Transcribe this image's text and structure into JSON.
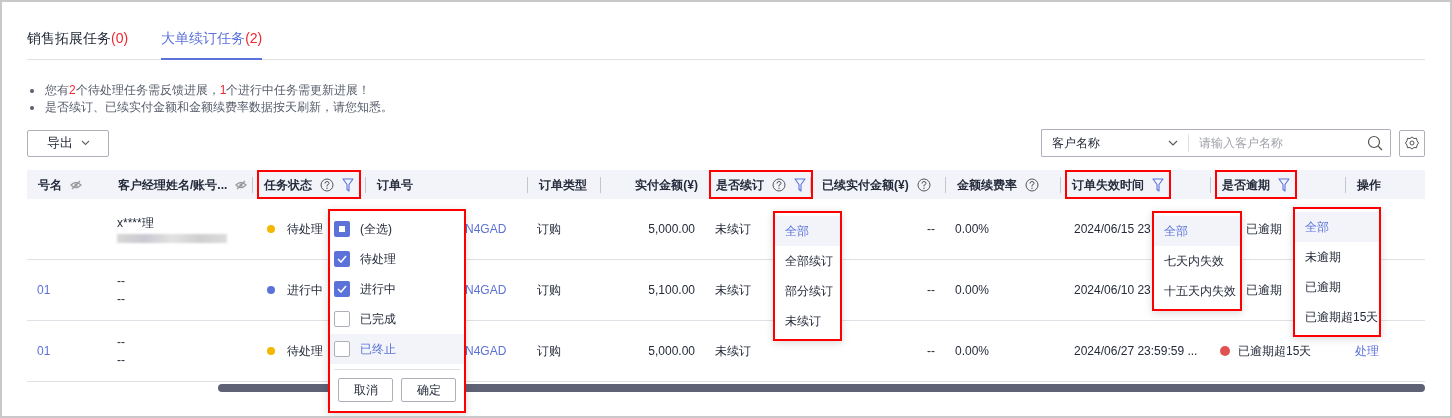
{
  "tabs": [
    {
      "label": "销售拓展任务",
      "count": "(0)",
      "selected": false
    },
    {
      "label": "大单续订任务",
      "count": "(2)",
      "selected": true
    }
  ],
  "notices": [
    [
      {
        "text": "您有",
        "highlight": false
      },
      {
        "text": "2",
        "highlight": true
      },
      {
        "text": "个待处理任务需反馈进展，",
        "highlight": false
      },
      {
        "text": "1",
        "highlight": true
      },
      {
        "text": "个进行中任务需更新进展！",
        "highlight": false
      }
    ],
    [
      {
        "text": "是否续订、已续实付金额和金额续费率数据按天刷新，请您知悉。",
        "highlight": false
      }
    ]
  ],
  "toolbar": {
    "export_button": "导出",
    "search_scope": "客户名称",
    "search_placeholder": "请输入客户名称"
  },
  "table": {
    "columns": [
      {
        "label": "号名",
        "hide_toggle": true,
        "help": false,
        "filter": false,
        "highlighted": false
      },
      {
        "label": "客户经理姓名/账号...",
        "hide_toggle": true,
        "help": false,
        "filter": false,
        "highlighted": false
      },
      {
        "label": "任务状态",
        "hide_toggle": false,
        "help": true,
        "filter": true,
        "highlighted": true
      },
      {
        "label": "订单号",
        "hide_toggle": false,
        "help": false,
        "filter": false,
        "highlighted": false
      },
      {
        "label": "订单类型",
        "hide_toggle": false,
        "help": false,
        "filter": false,
        "highlighted": false
      },
      {
        "label": "实付金额(¥)",
        "hide_toggle": false,
        "help": false,
        "filter": false,
        "highlighted": false
      },
      {
        "label": "是否续订",
        "hide_toggle": false,
        "help": true,
        "filter": true,
        "highlighted": true
      },
      {
        "label": "已续实付金额(¥)",
        "hide_toggle": false,
        "help": true,
        "filter": false,
        "highlighted": false
      },
      {
        "label": "金额续费率",
        "hide_toggle": false,
        "help": true,
        "filter": false,
        "highlighted": false
      },
      {
        "label": "订单失效时间",
        "hide_toggle": false,
        "help": false,
        "filter": true,
        "highlighted": true
      },
      {
        "label": "是否逾期",
        "hide_toggle": false,
        "help": false,
        "filter": true,
        "highlighted": true
      },
      {
        "label": "操作",
        "hide_toggle": false,
        "help": false,
        "filter": false,
        "highlighted": false
      }
    ],
    "rows": [
      {
        "manager": [
          "x****理"
        ],
        "manager_blurred": true,
        "status": {
          "label": "待处理",
          "color": "#f5b800"
        },
        "order": "N4GAD",
        "type": "订购",
        "amount": "5,000.00",
        "renewal": "未续订",
        "renewed_amount": "--",
        "rate": "0.00%",
        "expiry": "2024/06/15 23",
        "overdue": {
          "label": "已逾期"
        }
      },
      {
        "account": "01",
        "manager": [
          "--",
          "--"
        ],
        "manager_blurred": false,
        "status": {
          "label": "进行中",
          "color": "#5b72d9"
        },
        "order": "N4GAD",
        "type": "订购",
        "amount": "5,100.00",
        "renewal": "未续订",
        "renewed_amount": "--",
        "rate": "0.00%",
        "expiry": "2024/06/10 23",
        "overdue": {
          "label": "已逾期"
        }
      },
      {
        "account": "01",
        "manager": [
          "--",
          "--"
        ],
        "manager_blurred": false,
        "status": {
          "label": "待处理",
          "color": "#f5b800"
        },
        "order": "N4GAD",
        "type": "订购",
        "amount": "5,000.00",
        "renewal": "未续订",
        "renewed_amount": "--",
        "rate": "0.00%",
        "expiry": "2024/06/27 23:59:59 ...",
        "overdue": {
          "label": "已逾期超15天",
          "color": "#e05252"
        },
        "action": "处理"
      }
    ]
  },
  "filters": [
    {
      "kind": "checklist",
      "items": [
        {
          "label": "(全选)",
          "indeterminate": true,
          "hovered": false
        },
        {
          "label": "待处理",
          "checked": true,
          "hovered": false
        },
        {
          "label": "进行中",
          "checked": true,
          "hovered": false
        },
        {
          "label": "已完成",
          "checked": false,
          "hovered": false
        },
        {
          "label": "已终止",
          "checked": false,
          "hovered": true
        }
      ],
      "buttons": [
        "取消",
        "确定"
      ]
    },
    {
      "kind": "options",
      "items": [
        {
          "label": "全部",
          "selected": true
        },
        {
          "label": "全部续订",
          "selected": false
        },
        {
          "label": "部分续订",
          "selected": false
        },
        {
          "label": "未续订",
          "selected": false
        }
      ]
    },
    {
      "kind": "options",
      "items": [
        {
          "label": "全部",
          "selected": true
        },
        {
          "label": "七天内失效",
          "selected": false
        },
        {
          "label": "十五天内失效",
          "selected": false
        }
      ]
    },
    {
      "kind": "options",
      "items": [
        {
          "label": "全部",
          "selected": true
        },
        {
          "label": "未逾期",
          "selected": false
        },
        {
          "label": "已逾期",
          "selected": false
        },
        {
          "label": "已逾期超15天",
          "selected": false
        }
      ]
    }
  ]
}
